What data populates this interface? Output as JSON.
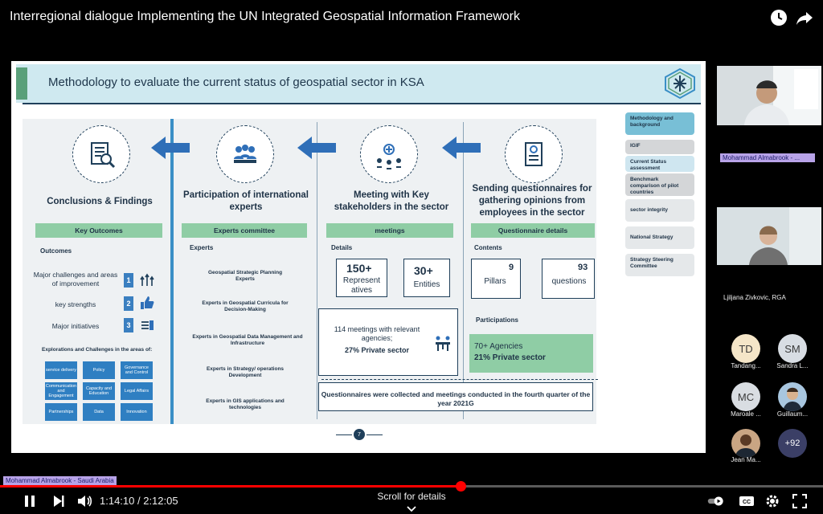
{
  "player": {
    "title": "Interregional dialogue Implementing the UN Integrated Geospatial Information Framework",
    "current_time": "1:14:10",
    "separator": " / ",
    "duration": "2:12:05",
    "progress_fraction": 0.56,
    "scroll_label": "Scroll for details",
    "speaker_tag": "Mohammad Almabrook - Saudi Arabia"
  },
  "slide": {
    "title": "Methodology to evaluate  the current status of geospatial sector in KSA",
    "page_number": "7",
    "columns": {
      "conclusions": {
        "heading": "Conclusions & Findings",
        "bar": "Key  Outcomes",
        "outcomes_label": "Outcomes",
        "items": [
          {
            "num": "1",
            "text": "Major challenges and areas of improvement"
          },
          {
            "num": "2",
            "text": "key strengths"
          },
          {
            "num": "3",
            "text": "Major initiatives"
          }
        ],
        "explorations_label": "Explorations and Challenges in the areas of:",
        "tiles": [
          "service delivery",
          "Policy",
          "Governance and Control",
          "Communication and Engagement",
          "Capacity and Education",
          "Legal Affairs",
          "Partnerships",
          "Data",
          "Innovation"
        ]
      },
      "experts": {
        "heading": "Participation of international experts",
        "bar": "Experts committee",
        "label": "Experts",
        "items": [
          "Geospatial Strategic Planning Experts",
          "Experts in Geospatial Curricula for Decision-Making",
          "Experts in Geospatial Data Management and Infrastructure",
          "Experts in Strategy/ operations Development",
          "Experts in GIS applications and technologies"
        ]
      },
      "meetings": {
        "heading": "Meeting with Key stakeholders in the sector",
        "bar": "meetings",
        "label": "Details",
        "stat1_num": "150+",
        "stat1_txt": "Represent atives",
        "stat2_num": "30+",
        "stat2_txt": "Entities",
        "meetings_line1": "114 meetings with relevant agencies;",
        "meetings_line2": "27% Private sector"
      },
      "questionnaires": {
        "heading": "Sending questionnaires for gathering opinions from employees in the sector",
        "bar": "Questionnaire details",
        "label": "Contents",
        "stat1_num": "9",
        "stat1_txt": "Pillars",
        "stat2_num": "93",
        "stat2_txt": "questions",
        "participations_label": "Participations",
        "part_line1": "70+ Agencies",
        "part_line2": "21%   Private sector"
      }
    },
    "bottom_note": "Questionnaires were collected and meetings conducted in the fourth quarter of the year 2021G",
    "nav": [
      "Methodology and background",
      "IGIF",
      "Current Status assessment",
      "Benchmark comparison of pilot countries",
      "sector integrity",
      "National Strategy",
      "Strategy Steering Committee"
    ]
  },
  "participants": {
    "speaker1": "Mohammad Almabrook - ...",
    "speaker2": "Ljiljana Zivkovic, RGA",
    "avatars": [
      {
        "initials": "TD",
        "name": "Tandang...",
        "color": "#f5e6c8"
      },
      {
        "initials": "SM",
        "name": "Sandra L...",
        "color": "#d8dde3"
      },
      {
        "initials": "MC",
        "name": "Maroale ...",
        "color": "#d9dde2"
      },
      {
        "initials": "",
        "name": "Guillaum...",
        "color": "#a8c6df"
      },
      {
        "initials": "",
        "name": "Jean Ma...",
        "color": "#c9a583"
      },
      {
        "initials": "+92",
        "name": "",
        "color": "#3b3f66"
      }
    ]
  },
  "colors": {
    "progress": "#ff0000",
    "slide_header": "#cfe9f0",
    "green": "#8fcda5",
    "blue_arrow": "#2f6fb8"
  }
}
